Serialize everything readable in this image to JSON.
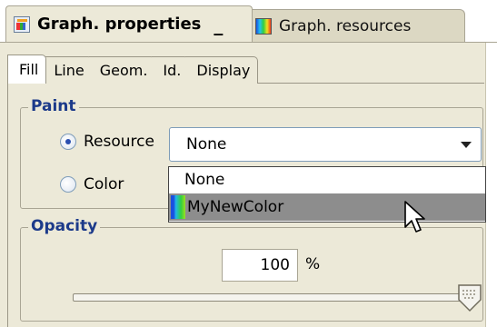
{
  "view_tabs": [
    {
      "label": "Graph. properties",
      "active": true,
      "icon": "graph-properties-icon"
    },
    {
      "label": "Graph. resources",
      "active": false,
      "icon": "graph-resources-icon"
    }
  ],
  "minimize_label": "_",
  "sub_tabs": [
    "Fill",
    "Line",
    "Geom.",
    "Id.",
    "Display"
  ],
  "paint": {
    "title": "Paint",
    "resource_label": "Resource",
    "color_label": "Color",
    "selected_option": "Resource",
    "combo_value": "None",
    "dropdown_options": [
      {
        "label": "None",
        "swatch": false
      },
      {
        "label": "MyNewColor",
        "swatch": true
      }
    ]
  },
  "opacity": {
    "title": "Opacity",
    "value": "100",
    "unit": "%",
    "slider_level": 1.0
  },
  "colors": {
    "panel_bg": "#ece9d8",
    "group_title": "#1c3a8a",
    "selection": "#8d8d8d"
  }
}
